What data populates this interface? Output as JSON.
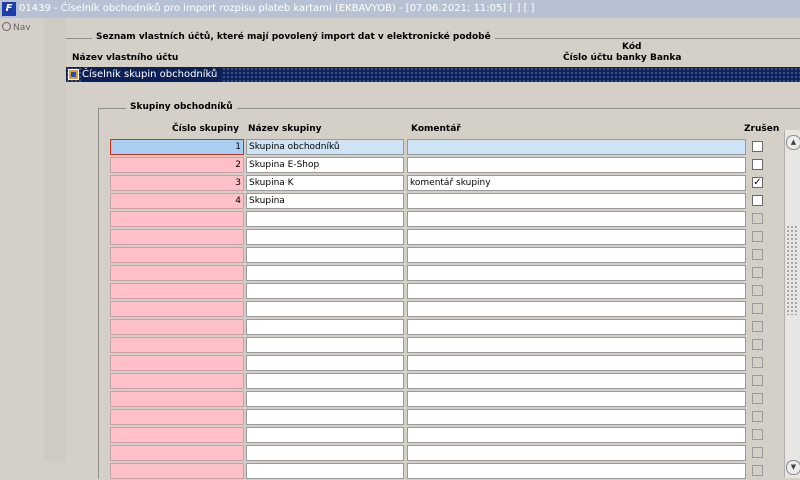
{
  "window": {
    "title": "01439 - Číselník obchodníků pro import rozpisu plateb kartami (EKBAVYOB) - [07.06.2021; 11:05] [ ] [ ]",
    "nav_label": "Nav"
  },
  "accounts_section": {
    "label": "Seznam vlastních účtů, které mají povolený import dat v elektronické podobě",
    "col_name": "Název vlastního účtu",
    "col_account": "Číslo účtu",
    "col_bank_code_1": "Kód",
    "col_bank_code_2": "banky",
    "col_bank": "Banka"
  },
  "subwindow": {
    "title": "Číselník skupin obchodníků"
  },
  "groups": {
    "label": "Skupiny obchodníků",
    "columns": {
      "number": "Číslo skupiny",
      "name": "Název skupiny",
      "comment": "Komentář",
      "cancelled": "Zrušen"
    },
    "rows": [
      {
        "number": "1",
        "name": "Skupina obchodníků",
        "comment": "",
        "cancelled": false,
        "current": true
      },
      {
        "number": "2",
        "name": "Skupina E-Shop",
        "comment": "",
        "cancelled": false
      },
      {
        "number": "3",
        "name": "Skupina K",
        "comment": "komentář skupiny",
        "cancelled": true
      },
      {
        "number": "4",
        "name": "Skupina",
        "comment": "",
        "cancelled": false
      },
      {
        "number": "",
        "name": "",
        "comment": "",
        "disabled": true
      },
      {
        "number": "",
        "name": "",
        "comment": "",
        "disabled": true
      },
      {
        "number": "",
        "name": "",
        "comment": "",
        "disabled": true
      },
      {
        "number": "",
        "name": "",
        "comment": "",
        "disabled": true
      },
      {
        "number": "",
        "name": "",
        "comment": "",
        "disabled": true
      },
      {
        "number": "",
        "name": "",
        "comment": "",
        "disabled": true
      },
      {
        "number": "",
        "name": "",
        "comment": "",
        "disabled": true
      },
      {
        "number": "",
        "name": "",
        "comment": "",
        "disabled": true
      },
      {
        "number": "",
        "name": "",
        "comment": "",
        "disabled": true
      },
      {
        "number": "",
        "name": "",
        "comment": "",
        "disabled": true
      },
      {
        "number": "",
        "name": "",
        "comment": "",
        "disabled": true
      },
      {
        "number": "",
        "name": "",
        "comment": "",
        "disabled": true
      },
      {
        "number": "",
        "name": "",
        "comment": "",
        "disabled": true
      },
      {
        "number": "",
        "name": "",
        "comment": "",
        "disabled": true
      },
      {
        "number": "",
        "name": "",
        "comment": "",
        "disabled": true
      }
    ]
  },
  "colors": {
    "titlebar": "#b7c1d3",
    "subwindow_title": "#0c2058",
    "number_cell": "#ffc0c8",
    "current_row": "#a8cff2"
  }
}
